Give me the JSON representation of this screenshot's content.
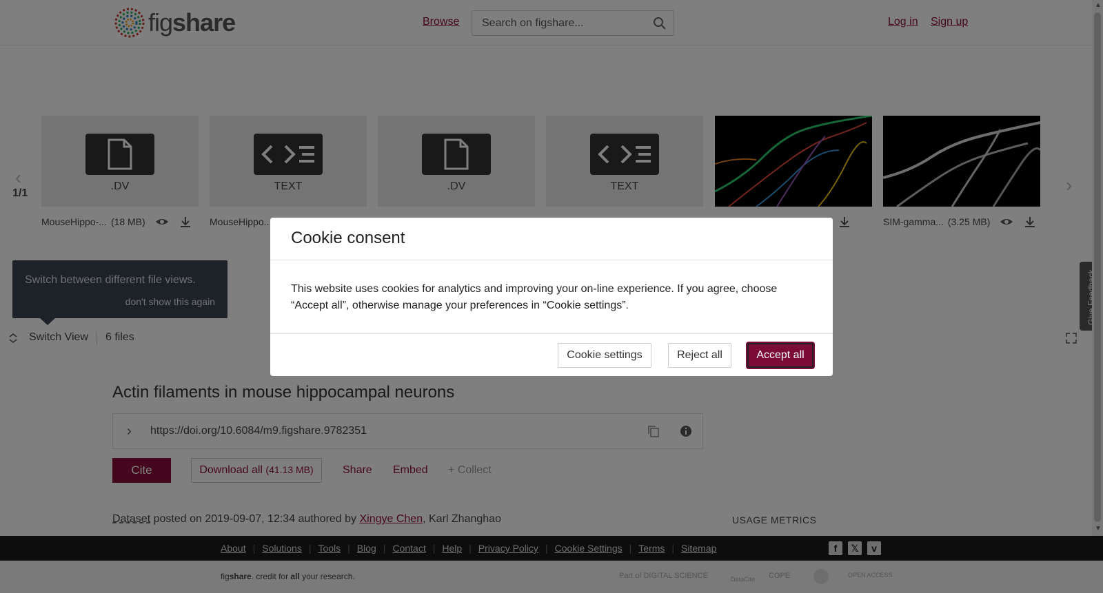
{
  "header": {
    "logo_text_light": "fig",
    "logo_text_bold": "share",
    "browse": "Browse",
    "search_placeholder": "Search on figshare...",
    "login": "Log in",
    "signup": "Sign up"
  },
  "carousel": {
    "page_count": "1/1",
    "files": [
      {
        "ext": ".DV",
        "icon": "file-icon",
        "name": "MouseHippo-...",
        "size": "(18 MB)"
      },
      {
        "ext": "TEXT",
        "icon": "code-icon",
        "name": "MouseHippo..."
      },
      {
        "ext": ".DV",
        "icon": "file-icon"
      },
      {
        "ext": "TEXT",
        "icon": "code-icon"
      },
      {
        "ext": "",
        "icon": "image-thumbnail"
      },
      {
        "ext": "",
        "icon": "image-thumbnail",
        "name": "SIM-gamma...",
        "size": "(3.25 MB)"
      }
    ]
  },
  "tooltip": {
    "text": "Switch between different file views.",
    "dismiss": "don't show this again"
  },
  "switch_bar": {
    "label": "Switch View",
    "files_count": "6 files"
  },
  "feedback": "Give Feedback",
  "article": {
    "title": "Actin filaments in mouse hippocampal neurons",
    "doi": "https://doi.org/10.6084/m9.figshare.9782351",
    "cite": "Cite",
    "download_label": "Download all",
    "download_size": "(41.13 MB)",
    "share": "Share",
    "embed": "Embed",
    "collect": "+ Collect",
    "posted_type": "Dataset",
    "posted_text": " posted on 2019-09-07, 12:34 authored by ",
    "author1": "Xingye Chen",
    "author2": ", Karl Zhanghao",
    "usage_metrics": "USAGE METRICS"
  },
  "footer": {
    "links": [
      "About",
      "Solutions",
      "Tools",
      "Blog",
      "Contact",
      "Help",
      "Privacy Policy",
      "Cookie Settings",
      "Terms",
      "Sitemap"
    ],
    "tagline_fig": "fig",
    "tagline_share": "share",
    "tagline_mid": ". credit for ",
    "tagline_all": "all",
    "tagline_end": " your research.",
    "partner_ds": "Part of DIGITAL SCIENCE",
    "partner_datacite": "DataCite",
    "partner_cope": "COPE",
    "partner_oa": "OPEN ACCESS"
  },
  "cookie_modal": {
    "title": "Cookie consent",
    "body": "This website uses cookies for analytics and improving your on-line experience. If you agree, choose “Accept all”, otherwise manage your preferences in “Cookie settings”.",
    "settings": "Cookie settings",
    "reject": "Reject all",
    "accept": "Accept all"
  },
  "colors": {
    "brand": "#8b0e3a",
    "accept": "#7a0c35"
  }
}
